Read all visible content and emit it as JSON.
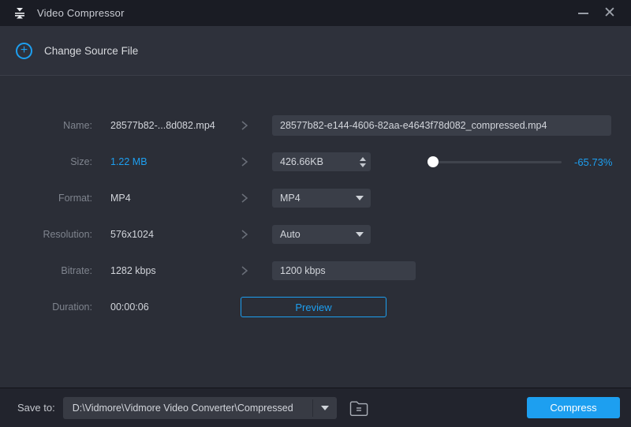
{
  "window": {
    "title": "Video Compressor"
  },
  "titlebar": {
    "close_glyph": "✕"
  },
  "header": {
    "change_source_label": "Change Source File",
    "plus_glyph": "+"
  },
  "rows": {
    "name": {
      "label": "Name:",
      "value": "28577b82-...8d082.mp4",
      "input_value": "28577b82-e144-4606-82aa-e4643f78d082_compressed.mp4"
    },
    "size": {
      "label": "Size:",
      "value": "1.22 MB",
      "input_value": "426.66KB",
      "percent": "-65.73%",
      "slider_position": "0%"
    },
    "format": {
      "label": "Format:",
      "value": "MP4",
      "selected": "MP4"
    },
    "resolution": {
      "label": "Resolution:",
      "value": "576x1024",
      "selected": "Auto"
    },
    "bitrate": {
      "label": "Bitrate:",
      "value": "1282 kbps",
      "input_value": "1200 kbps"
    },
    "duration": {
      "label": "Duration:",
      "value": "00:00:06",
      "preview_label": "Preview"
    }
  },
  "footer": {
    "save_to_label": "Save to:",
    "path": "D:\\Vidmore\\Vidmore Video Converter\\Compressed",
    "compress_label": "Compress"
  },
  "colors": {
    "accent": "#1d9ff0",
    "background": "#2b2e37",
    "titlebar": "#1a1c24",
    "footer": "#22242d",
    "field": "#3a3e48"
  }
}
